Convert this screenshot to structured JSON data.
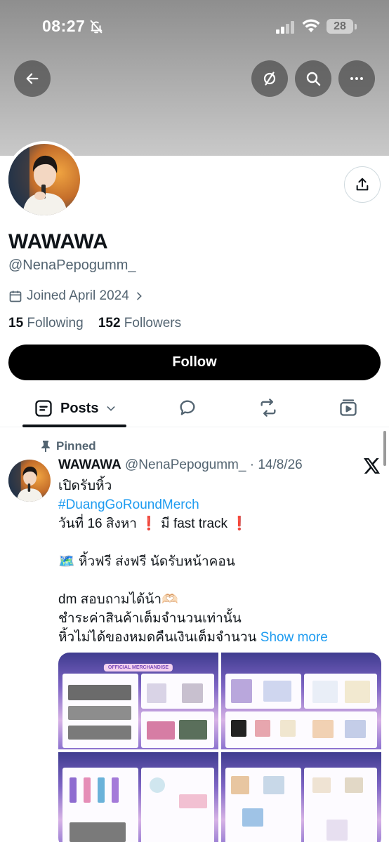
{
  "status_bar": {
    "time": "08:27",
    "battery": "28"
  },
  "profile": {
    "name": "WAWAWA",
    "handle": "@NenaPepogumm_",
    "joined": "Joined April 2024",
    "following_count": "15",
    "following_label": "Following",
    "followers_count": "152",
    "followers_label": "Followers",
    "follow_button": "Follow"
  },
  "tabs": {
    "posts": "Posts"
  },
  "post": {
    "pinned_label": "Pinned",
    "author_name": "WAWAWA",
    "author_handle": "@NenaPepogumm_",
    "separator": "·",
    "date": "14/8/26",
    "lines": {
      "l1": "เปิดรับหิ้ว",
      "hashtag": "#DuangGoRoundMerch",
      "l3": " วันที่ 16 สิงหา ❗️ มี fast track ❗️",
      "l5": "🗺️ หิ้วฟรี ส่งฟรี นัดรับหน้าคอน",
      "l7": " dm สอบถามได้น้า🫶🏻",
      "l8": "ชำระค่าสินค้าเต็มจำนวนเท่านั้น",
      "l9": "หิ้วไม่ได้ของหมดคืนเงินเต็มจำนวน",
      "show_more": "Show more"
    },
    "media_title": "OFFICIAL MERCHANDISE"
  },
  "colors": {
    "accent": "#1d9bf0",
    "follow_bg": "#000000",
    "muted": "#536471"
  },
  "icons": [
    "back-arrow-icon",
    "hide-icon",
    "search-icon",
    "more-icon",
    "share-icon",
    "calendar-icon",
    "chevron-right-icon",
    "posts-icon",
    "chevron-down-icon",
    "replies-icon",
    "reposts-icon",
    "media-icon",
    "pin-icon",
    "x-logo-icon"
  ]
}
